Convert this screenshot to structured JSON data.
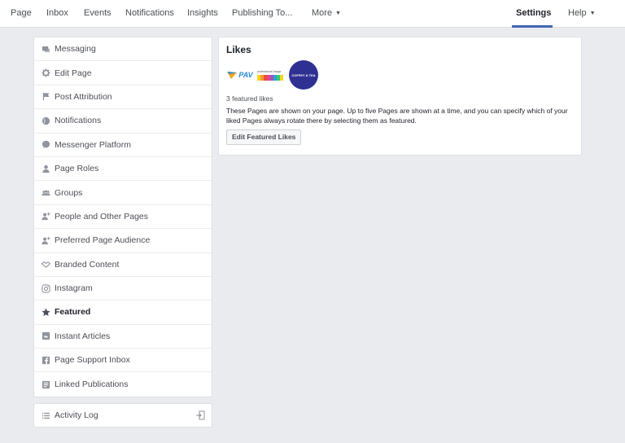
{
  "topnav": {
    "items": [
      "Page",
      "Inbox",
      "Events",
      "Notifications",
      "Insights",
      "Publishing To..."
    ],
    "more_label": "More",
    "settings_label": "Settings",
    "help_label": "Help"
  },
  "sidebar": {
    "items": [
      {
        "label": "Messaging",
        "icon": "messaging-icon"
      },
      {
        "label": "Edit Page",
        "icon": "gear-icon"
      },
      {
        "label": "Post Attribution",
        "icon": "flag-icon"
      },
      {
        "label": "Notifications",
        "icon": "globe-icon"
      },
      {
        "label": "Messenger Platform",
        "icon": "messenger-icon"
      },
      {
        "label": "Page Roles",
        "icon": "person-icon"
      },
      {
        "label": "Groups",
        "icon": "groups-icon"
      },
      {
        "label": "People and Other Pages",
        "icon": "person-plus-icon"
      },
      {
        "label": "Preferred Page Audience",
        "icon": "audience-icon"
      },
      {
        "label": "Branded Content",
        "icon": "handshake-icon"
      },
      {
        "label": "Instagram",
        "icon": "instagram-icon"
      },
      {
        "label": "Featured",
        "icon": "star-icon"
      },
      {
        "label": "Instant Articles",
        "icon": "articles-icon"
      },
      {
        "label": "Page Support Inbox",
        "icon": "facebook-icon"
      },
      {
        "label": "Linked Publications",
        "icon": "publications-icon"
      }
    ],
    "selected_index": 11
  },
  "activity_log": {
    "label": "Activity Log",
    "icon": "list-icon"
  },
  "likes": {
    "title": "Likes",
    "featured_count": "3 featured likes",
    "description": "These Pages are shown on your page. Up to five Pages are shown at a time, and you can specify which of your liked Pages always rotate there by selecting them as featured.",
    "button_label": "Edit Featured Likes",
    "logos": [
      {
        "name": "PAV",
        "text": "PAV"
      },
      {
        "name": "stripes-logo",
        "text": "professional image"
      },
      {
        "name": "coffey-tea-logo",
        "text": "COFFEY & TEA"
      }
    ]
  },
  "colors": {
    "accent": "#4267b2",
    "background": "#e9ebee",
    "logo_circle": "#2e3192"
  }
}
